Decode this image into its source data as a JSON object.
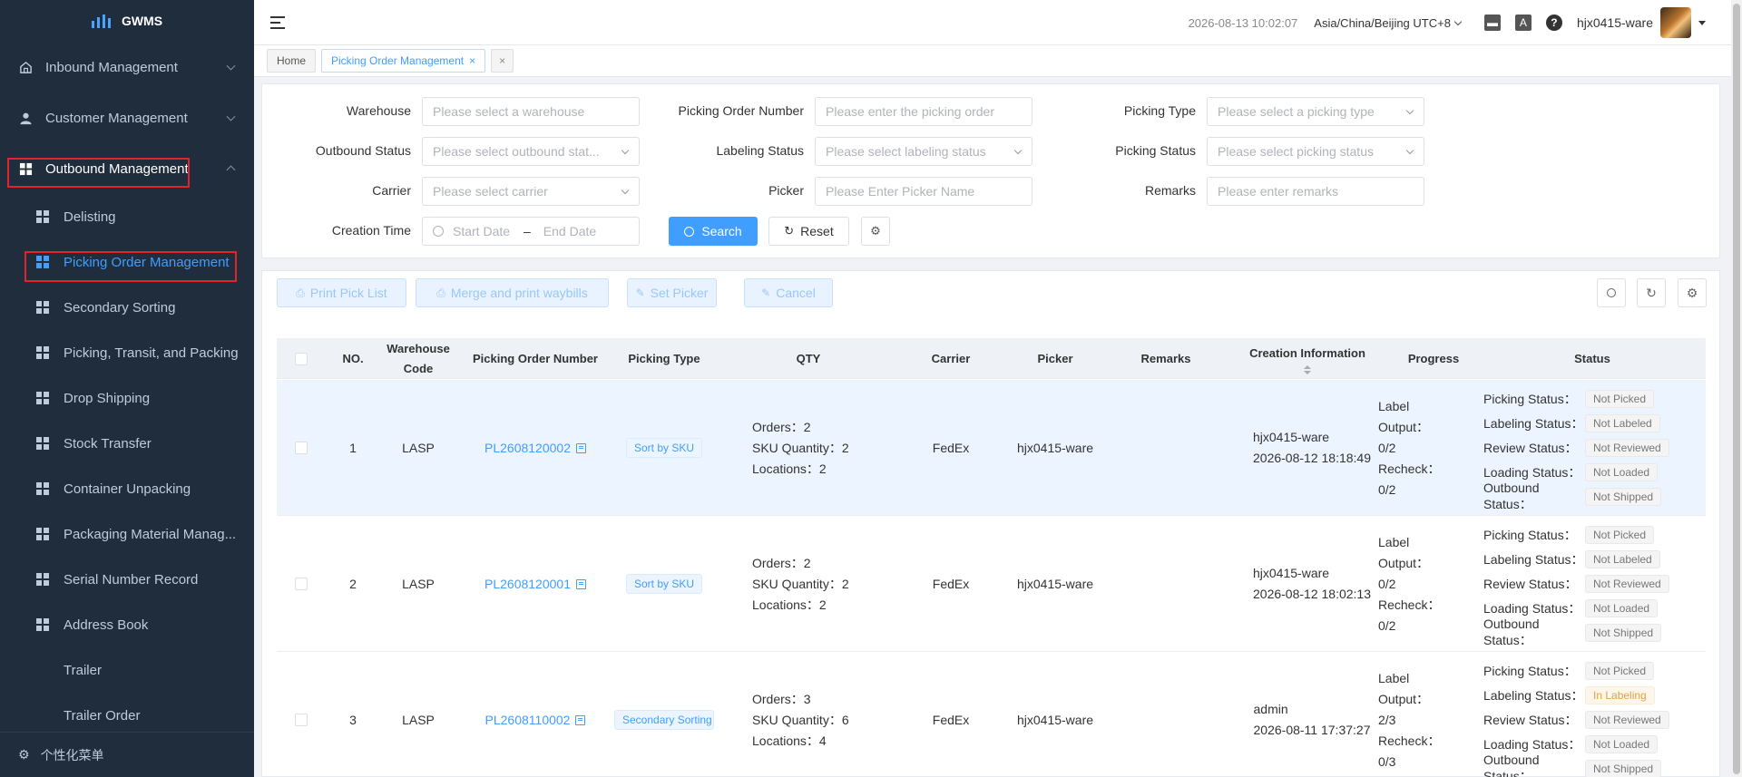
{
  "app": {
    "name": "GWMS"
  },
  "sidebar": {
    "groups": [
      {
        "label": "Inbound Management",
        "icon": "home-icon"
      },
      {
        "label": "Customer Management",
        "icon": "user-icon"
      },
      {
        "label": "Outbound Management",
        "icon": "grid-icon"
      }
    ],
    "subitems": [
      {
        "label": "Delisting"
      },
      {
        "label": "Picking Order Management"
      },
      {
        "label": "Secondary Sorting"
      },
      {
        "label": "Picking, Transit, and Packing"
      },
      {
        "label": "Drop Shipping"
      },
      {
        "label": "Stock Transfer"
      },
      {
        "label": "Container Unpacking"
      },
      {
        "label": "Packaging Material Manag..."
      },
      {
        "label": "Serial Number Record"
      },
      {
        "label": "Address Book"
      },
      {
        "label": "Trailer"
      },
      {
        "label": "Trailer Order"
      }
    ],
    "footer": "个性化菜单"
  },
  "header": {
    "datetime": "2026-08-13 10:02:07",
    "timezone": "Asia/China/Beijing UTC+8",
    "username": "hjx0415-ware",
    "icons": [
      "message-icon",
      "translate-icon",
      "help-icon"
    ]
  },
  "tabs": [
    {
      "label": "Home"
    },
    {
      "label": "Picking Order Management"
    }
  ],
  "filters": {
    "warehouse": {
      "label": "Warehouse",
      "placeholder": "Please select a warehouse"
    },
    "picking_order_number": {
      "label": "Picking Order Number",
      "placeholder": "Please enter the picking order"
    },
    "picking_type": {
      "label": "Picking Type",
      "placeholder": "Please select a picking type"
    },
    "outbound_status": {
      "label": "Outbound Status",
      "placeholder": "Please select outbound stat..."
    },
    "labeling_status": {
      "label": "Labeling Status",
      "placeholder": "Please select labeling status"
    },
    "picking_status": {
      "label": "Picking Status",
      "placeholder": "Please select picking status"
    },
    "carrier": {
      "label": "Carrier",
      "placeholder": "Please select carrier"
    },
    "picker": {
      "label": "Picker",
      "placeholder": "Please Enter Picker Name"
    },
    "remarks": {
      "label": "Remarks",
      "placeholder": "Please enter remarks"
    },
    "creation_time": {
      "label": "Creation Time",
      "start": "Start Date",
      "sep": "–",
      "end": "End Date"
    },
    "search_label": "Search",
    "reset_label": "Reset"
  },
  "actions": {
    "print_pick_list": "Print Pick List",
    "merge_print": "Merge and print waybills",
    "set_picker": "Set Picker",
    "cancel": "Cancel"
  },
  "table": {
    "columns": {
      "no": "NO.",
      "warehouse_code": "Warehouse Code",
      "picking_order_number": "Picking Order Number",
      "picking_type": "Picking Type",
      "qty": "QTY",
      "carrier": "Carrier",
      "picker": "Picker",
      "remarks": "Remarks",
      "creation_info": "Creation Information",
      "progress": "Progress",
      "status": "Status"
    },
    "rows": [
      {
        "no": "1",
        "warehouse": "LASP",
        "order_no": "PL2608120002",
        "type": "Sort by SKU",
        "qty": [
          "Orders：2",
          "SKU Quantity：2",
          "Locations：2"
        ],
        "carrier": "FedEx",
        "picker": "hjx0415-ware",
        "remarks": "",
        "creator": "hjx0415-ware",
        "created": "2026-08-12 18:18:49",
        "progress": [
          "Label",
          "Output：",
          "0/2",
          "Recheck：",
          "0/2"
        ],
        "statuses": [
          {
            "label": "Picking Status：",
            "value": "Not Picked"
          },
          {
            "label": "Labeling Status：",
            "value": "Not Labeled"
          },
          {
            "label": "Review Status：",
            "value": "Not Reviewed"
          },
          {
            "label": "Loading Status：",
            "value": "Not Loaded"
          },
          {
            "label": "Outbound Status：",
            "value": "Not Shipped"
          }
        ]
      },
      {
        "no": "2",
        "warehouse": "LASP",
        "order_no": "PL2608120001",
        "type": "Sort by SKU",
        "qty": [
          "Orders：2",
          "SKU Quantity：2",
          "Locations：2"
        ],
        "carrier": "FedEx",
        "picker": "hjx0415-ware",
        "remarks": "",
        "creator": "hjx0415-ware",
        "created": "2026-08-12 18:02:13",
        "progress": [
          "Label",
          "Output：",
          "0/2",
          "Recheck：",
          "0/2"
        ],
        "statuses": [
          {
            "label": "Picking Status：",
            "value": "Not Picked"
          },
          {
            "label": "Labeling Status：",
            "value": "Not Labeled"
          },
          {
            "label": "Review Status：",
            "value": "Not Reviewed"
          },
          {
            "label": "Loading Status：",
            "value": "Not Loaded"
          },
          {
            "label": "Outbound Status：",
            "value": "Not Shipped"
          }
        ]
      },
      {
        "no": "3",
        "warehouse": "LASP",
        "order_no": "PL2608110002",
        "type": "Secondary Sorting",
        "qty": [
          "Orders：3",
          "SKU Quantity：6",
          "Locations：4"
        ],
        "carrier": "FedEx",
        "picker": "hjx0415-ware",
        "remarks": "",
        "creator": "admin",
        "created": "2026-08-11 17:37:27",
        "progress": [
          "Label",
          "Output：",
          "2/3",
          "Recheck：",
          "0/3"
        ],
        "statuses": [
          {
            "label": "Picking Status：",
            "value": "Not Picked"
          },
          {
            "label": "Labeling Status：",
            "value": "In Labeling"
          },
          {
            "label": "Review Status：",
            "value": "Not Reviewed"
          },
          {
            "label": "Loading Status：",
            "value": "Not Loaded"
          },
          {
            "label": "Outbound Status：",
            "value": "Not Shipped"
          }
        ]
      }
    ]
  },
  "colors": {
    "sidebar_bg": "#1f2d3d",
    "primary": "#409eff",
    "highlight_border": "#e0242b",
    "warning": "#e6a23c"
  }
}
